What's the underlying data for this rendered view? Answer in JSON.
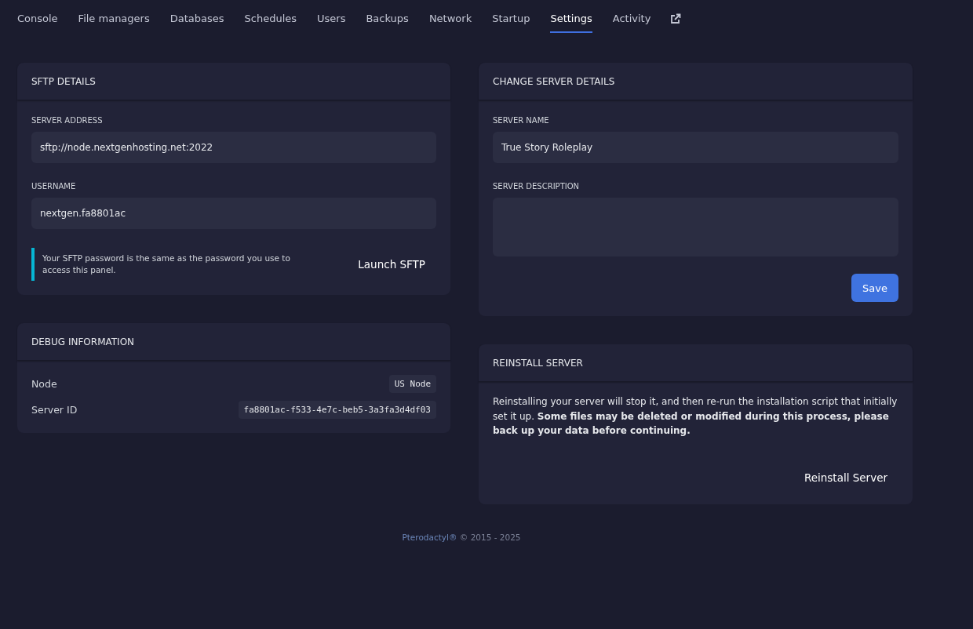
{
  "tabs": [
    {
      "label": "Console",
      "selected": false
    },
    {
      "label": "File managers",
      "selected": false
    },
    {
      "label": "Databases",
      "selected": false
    },
    {
      "label": "Schedules",
      "selected": false
    },
    {
      "label": "Users",
      "selected": false
    },
    {
      "label": "Backups",
      "selected": false
    },
    {
      "label": "Network",
      "selected": false
    },
    {
      "label": "Startup",
      "selected": false
    },
    {
      "label": "Settings",
      "selected": true
    },
    {
      "label": "Activity",
      "selected": false
    }
  ],
  "sftp_details": {
    "title": "SFTP DETAILS",
    "fields": [
      {
        "label": "SERVER ADDRESS",
        "value": "sftp://node.nextgenhosting.net:2022"
      },
      {
        "label": "USERNAME",
        "value": "nextgen.fa8801ac"
      }
    ],
    "note": "Your SFTP password is the same as the password you use to access this panel.",
    "button": "Launch SFTP"
  },
  "debug_information": {
    "title": "DEBUG INFORMATION",
    "rows": [
      {
        "label": "Node",
        "value": "US Node"
      },
      {
        "label": "Server ID",
        "value": "fa8801ac-f533-4e7c-beb5-3a3fa3d4df03"
      }
    ]
  },
  "change_server_details": {
    "title": "CHANGE SERVER DETAILS",
    "fields": [
      {
        "label": "SERVER NAME",
        "value": "True Story Roleplay",
        "kind": "input"
      },
      {
        "label": "SERVER DESCRIPTION",
        "kind": "textarea"
      }
    ],
    "button": "Save"
  },
  "reinstall_server": {
    "title": "REINSTALL SERVER",
    "text": "Reinstalling your server will stop it, and then re-run the installation script that initially set it up. **Some files may be deleted or modified during this process, please back up your data before continuing.**",
    "button": "Reinstall Server"
  },
  "footer": {
    "link": "Pterodactyl®",
    "text": "© 2015 - 2025"
  }
}
